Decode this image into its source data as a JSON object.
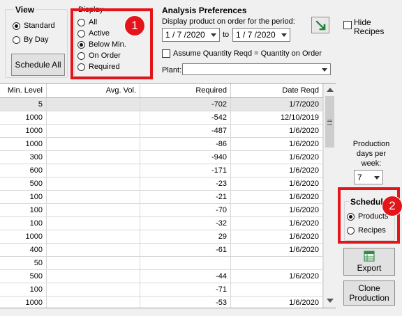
{
  "view": {
    "title": "View",
    "options": [
      "Standard",
      "By Day"
    ],
    "selected": "Standard",
    "schedule_all": "Schedule All"
  },
  "display": {
    "title": "Display",
    "options": [
      "All",
      "Active",
      "Below Min.",
      "On Order",
      "Required"
    ],
    "selected": "Below Min."
  },
  "analysis": {
    "title": "Analysis Preferences",
    "period_label": "Display product on order for the period:",
    "from_date": "1 / 7 /2020",
    "to_label": "to",
    "to_date": "1 / 7 /2020",
    "assume_label": "Assume Quantity Reqd = Quantity on Order",
    "plant_label": "Plant:",
    "plant_value": ""
  },
  "hide_recipes": "Hide\nRecipes",
  "production": {
    "label": "Production\ndays per\nweek:",
    "value": "7"
  },
  "schedule": {
    "title": "Schedule",
    "options": [
      "Products",
      "Recipes"
    ],
    "selected": "Products"
  },
  "export_label": "Export",
  "clone_label": "Clone\nProduction",
  "callouts": [
    "1",
    "2"
  ],
  "table": {
    "columns": [
      "Min. Level",
      "Avg. Vol.",
      "Required",
      "Date Reqd"
    ],
    "rows": [
      [
        "5",
        "",
        "-702",
        "1/7/2020"
      ],
      [
        "1000",
        "",
        "-542",
        "12/10/2019"
      ],
      [
        "1000",
        "",
        "-487",
        "1/6/2020"
      ],
      [
        "1000",
        "",
        "-86",
        "1/6/2020"
      ],
      [
        "300",
        "",
        "-940",
        "1/6/2020"
      ],
      [
        "600",
        "",
        "-171",
        "1/6/2020"
      ],
      [
        "500",
        "",
        "-23",
        "1/6/2020"
      ],
      [
        "100",
        "",
        "-21",
        "1/6/2020"
      ],
      [
        "100",
        "",
        "-70",
        "1/6/2020"
      ],
      [
        "100",
        "",
        "-32",
        "1/6/2020"
      ],
      [
        "1000",
        "",
        "29",
        "1/6/2020"
      ],
      [
        "400",
        "",
        "-61",
        "1/6/2020"
      ],
      [
        "50",
        "",
        "",
        ""
      ],
      [
        "500",
        "",
        "-44",
        "1/6/2020"
      ],
      [
        "100",
        "",
        "-71",
        ""
      ],
      [
        "1000",
        "",
        "-53",
        "1/6/2020"
      ]
    ]
  },
  "colors": {
    "callout": "#e3151a",
    "selected_row": "#e6e6e6"
  }
}
